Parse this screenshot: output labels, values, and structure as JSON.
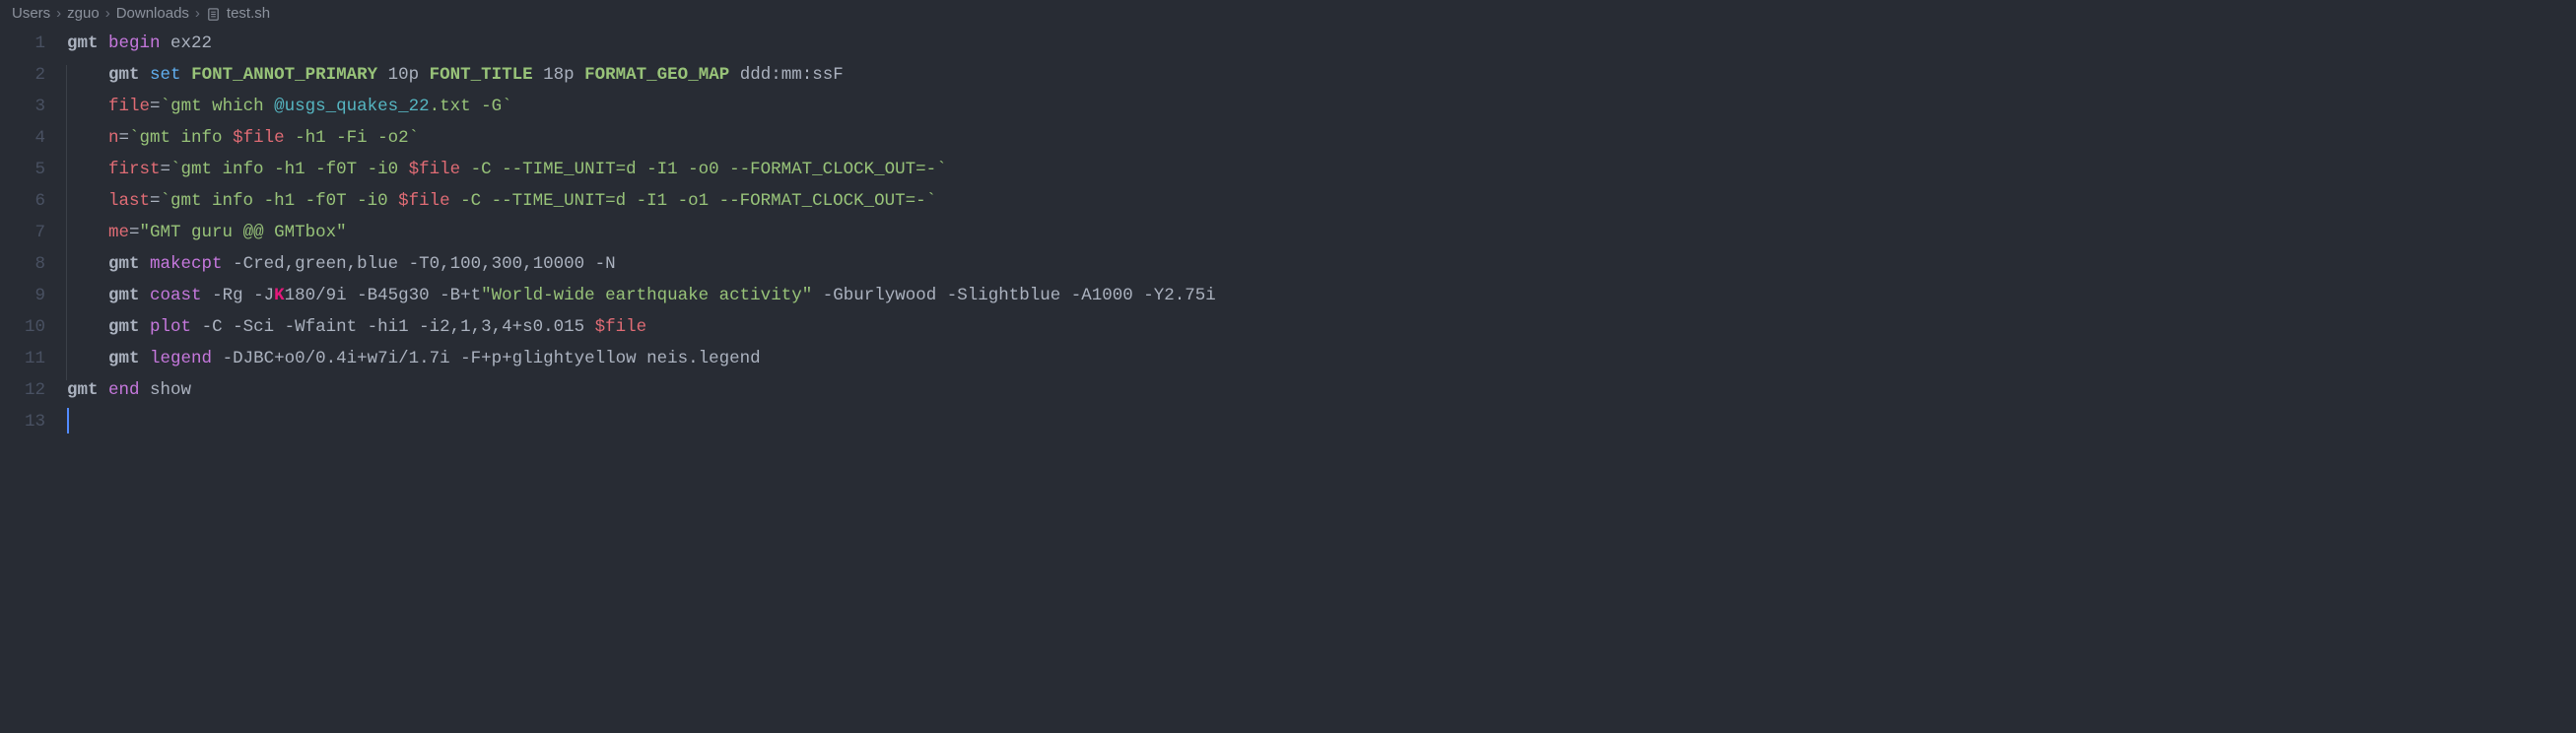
{
  "breadcrumb": {
    "segments": [
      "Users",
      "zguo",
      "Downloads"
    ],
    "filename": "test.sh",
    "separator": "›"
  },
  "editor": {
    "line_numbers": [
      "1",
      "2",
      "3",
      "4",
      "5",
      "6",
      "7",
      "8",
      "9",
      "10",
      "11",
      "12",
      "13"
    ],
    "lines": [
      [
        {
          "t": "gmt",
          "c": "cmd"
        },
        {
          "t": " ",
          "c": "plain"
        },
        {
          "t": "begin",
          "c": "kw"
        },
        {
          "t": " ex22",
          "c": "plain"
        }
      ],
      [
        {
          "t": "    ",
          "c": "plain"
        },
        {
          "t": "gmt",
          "c": "cmd"
        },
        {
          "t": " ",
          "c": "plain"
        },
        {
          "t": "set",
          "c": "fn"
        },
        {
          "t": " ",
          "c": "plain"
        },
        {
          "t": "FONT_ANNOT_PRIMARY",
          "c": "greenbold"
        },
        {
          "t": " 10p ",
          "c": "plain"
        },
        {
          "t": "FONT_TITLE",
          "c": "greenbold"
        },
        {
          "t": " 18p ",
          "c": "plain"
        },
        {
          "t": "FORMAT_GEO_MAP",
          "c": "greenbold"
        },
        {
          "t": " ddd:mm:ssF",
          "c": "plain"
        }
      ],
      [
        {
          "t": "    ",
          "c": "plain"
        },
        {
          "t": "file",
          "c": "var"
        },
        {
          "t": "=",
          "c": "plain"
        },
        {
          "t": "`",
          "c": "str"
        },
        {
          "t": "gmt which ",
          "c": "str"
        },
        {
          "t": "@usgs_quakes_22",
          "c": "cyan"
        },
        {
          "t": ".txt -G",
          "c": "str"
        },
        {
          "t": "`",
          "c": "str"
        }
      ],
      [
        {
          "t": "    ",
          "c": "plain"
        },
        {
          "t": "n",
          "c": "var"
        },
        {
          "t": "=",
          "c": "plain"
        },
        {
          "t": "`gmt info ",
          "c": "str"
        },
        {
          "t": "$file",
          "c": "var"
        },
        {
          "t": " -h1 -Fi -o2`",
          "c": "str"
        }
      ],
      [
        {
          "t": "    ",
          "c": "plain"
        },
        {
          "t": "first",
          "c": "var"
        },
        {
          "t": "=",
          "c": "plain"
        },
        {
          "t": "`gmt info -h1 -f0T -i0 ",
          "c": "str"
        },
        {
          "t": "$file",
          "c": "var"
        },
        {
          "t": " -C --TIME_UNIT=d -I1 -o0 --FORMAT_CLOCK_OUT=-`",
          "c": "str"
        }
      ],
      [
        {
          "t": "    ",
          "c": "plain"
        },
        {
          "t": "last",
          "c": "var"
        },
        {
          "t": "=",
          "c": "plain"
        },
        {
          "t": "`gmt info -h1 -f0T -i0 ",
          "c": "str"
        },
        {
          "t": "$file",
          "c": "var"
        },
        {
          "t": " -C --TIME_UNIT=d -I1 -o1 --FORMAT_CLOCK_OUT=-`",
          "c": "str"
        }
      ],
      [
        {
          "t": "    ",
          "c": "plain"
        },
        {
          "t": "me",
          "c": "var"
        },
        {
          "t": "=",
          "c": "plain"
        },
        {
          "t": "\"GMT guru @@ GMTbox\"",
          "c": "str"
        }
      ],
      [
        {
          "t": "    ",
          "c": "plain"
        },
        {
          "t": "gmt",
          "c": "cmd"
        },
        {
          "t": " ",
          "c": "plain"
        },
        {
          "t": "makecpt",
          "c": "kw"
        },
        {
          "t": " -Cred,green,blue -T0,100,300,10000 -N",
          "c": "plain"
        }
      ],
      [
        {
          "t": "    ",
          "c": "plain"
        },
        {
          "t": "gmt",
          "c": "cmd"
        },
        {
          "t": " ",
          "c": "plain"
        },
        {
          "t": "coast",
          "c": "kw"
        },
        {
          "t": " -Rg -J",
          "c": "plain"
        },
        {
          "t": "K",
          "c": "pink"
        },
        {
          "t": "180/9i -B45g30 -B+t",
          "c": "plain"
        },
        {
          "t": "\"World-wide earthquake activity\"",
          "c": "str"
        },
        {
          "t": " -Gburlywood -Slightblue -A1000 -Y2.75i",
          "c": "plain"
        }
      ],
      [
        {
          "t": "    ",
          "c": "plain"
        },
        {
          "t": "gmt",
          "c": "cmd"
        },
        {
          "t": " ",
          "c": "plain"
        },
        {
          "t": "plot",
          "c": "kw"
        },
        {
          "t": " -C -Sci -Wfaint -hi1 -i2,1,3,4+s0.015 ",
          "c": "plain"
        },
        {
          "t": "$file",
          "c": "var"
        }
      ],
      [
        {
          "t": "    ",
          "c": "plain"
        },
        {
          "t": "gmt",
          "c": "cmd"
        },
        {
          "t": " ",
          "c": "plain"
        },
        {
          "t": "legend",
          "c": "kw"
        },
        {
          "t": " -DJBC+o0/0.4i+w7i/1.7i -F+p+glightyellow neis.legend",
          "c": "plain"
        }
      ],
      [
        {
          "t": "gmt",
          "c": "cmd"
        },
        {
          "t": " ",
          "c": "plain"
        },
        {
          "t": "end",
          "c": "kw"
        },
        {
          "t": " show",
          "c": "plain"
        }
      ],
      []
    ]
  }
}
